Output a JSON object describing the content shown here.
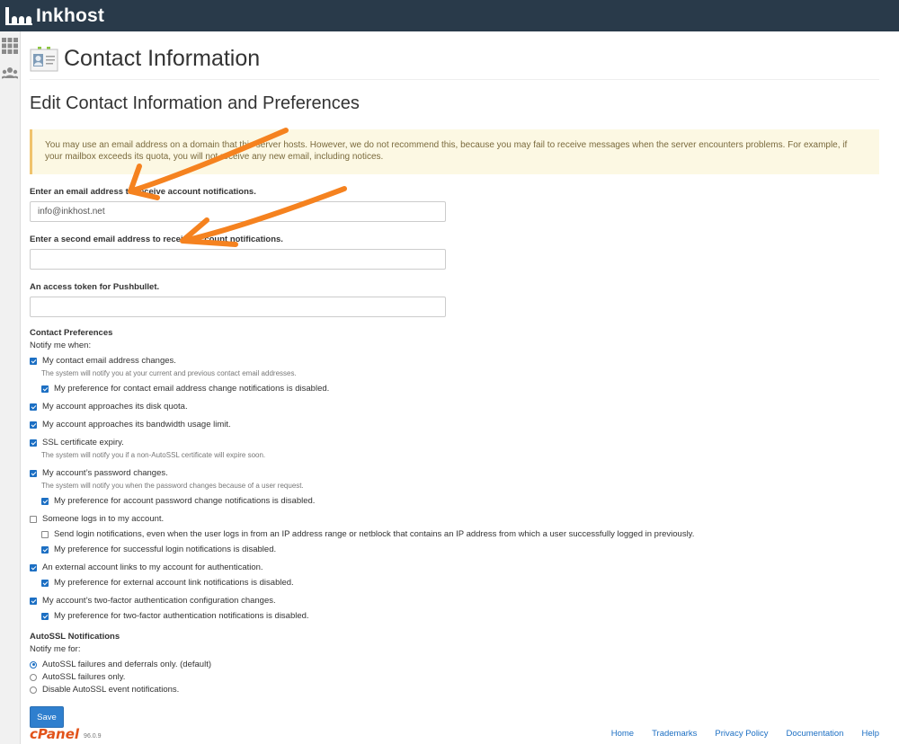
{
  "brand": {
    "name": "Inkhost"
  },
  "page": {
    "title": "Contact Information",
    "subtitle": "Edit Contact Information and Preferences"
  },
  "warning": "You may use an email address on a domain that this server hosts. However, we do not recommend this, because you may fail to receive messages when the server encounters problems. For example, if your mailbox exceeds its quota, you will not receive any new email, including notices.",
  "fields": {
    "email1": {
      "label": "Enter an email address to receive account notifications.",
      "value": "info@inkhost.net"
    },
    "email2": {
      "label": "Enter a second email address to receive account notifications.",
      "value": ""
    },
    "pushbullet": {
      "label": "An access token for Pushbullet.",
      "value": ""
    }
  },
  "contact_prefs": {
    "title": "Contact Preferences",
    "sub": "Notify me when:",
    "items": [
      {
        "label": "My contact email address changes.",
        "checked": true,
        "level": 1,
        "help": "The system will notify you at your current and previous contact email addresses."
      },
      {
        "label": "My preference for contact email address change notifications is disabled.",
        "checked": true,
        "level": 2
      },
      {
        "label": "My account approaches its disk quota.",
        "checked": true,
        "level": 1
      },
      {
        "label": "My account approaches its bandwidth usage limit.",
        "checked": true,
        "level": 1
      },
      {
        "label": "SSL certificate expiry.",
        "checked": true,
        "level": 1,
        "help": "The system will notify you if a non-AutoSSL certificate will expire soon."
      },
      {
        "label": "My account’s password changes.",
        "checked": true,
        "level": 1,
        "help": "The system will notify you when the password changes because of a user request."
      },
      {
        "label": "My preference for account password change notifications is disabled.",
        "checked": true,
        "level": 2
      },
      {
        "label": "Someone logs in to my account.",
        "checked": false,
        "level": 1
      },
      {
        "label": "Send login notifications, even when the user logs in from an IP address range or netblock that contains an IP address from which a user successfully logged in previously.",
        "checked": false,
        "level": 2
      },
      {
        "label": "My preference for successful login notifications is disabled.",
        "checked": true,
        "level": 2
      },
      {
        "label": "An external account links to my account for authentication.",
        "checked": true,
        "level": 1
      },
      {
        "label": "My preference for external account link notifications is disabled.",
        "checked": true,
        "level": 2
      },
      {
        "label": "My account’s two-factor authentication configuration changes.",
        "checked": true,
        "level": 1
      },
      {
        "label": "My preference for two-factor authentication notifications is disabled.",
        "checked": true,
        "level": 2
      }
    ]
  },
  "autossl": {
    "title": "AutoSSL Notifications",
    "sub": "Notify me for:",
    "options": [
      {
        "label": "AutoSSL failures and deferrals only. (default)",
        "selected": true
      },
      {
        "label": "AutoSSL failures only.",
        "selected": false
      },
      {
        "label": "Disable AutoSSL event notifications.",
        "selected": false
      }
    ]
  },
  "save_label": "Save",
  "footer": {
    "logo": "cPanel",
    "version": "96.0.9",
    "links": [
      "Home",
      "Trademarks",
      "Privacy Policy",
      "Documentation",
      "Help"
    ]
  },
  "colors": {
    "topbar": "#293a4a",
    "accent": "#1c6fc3",
    "annotation": "#f5821f",
    "warning_bg": "#fcf8e3"
  }
}
